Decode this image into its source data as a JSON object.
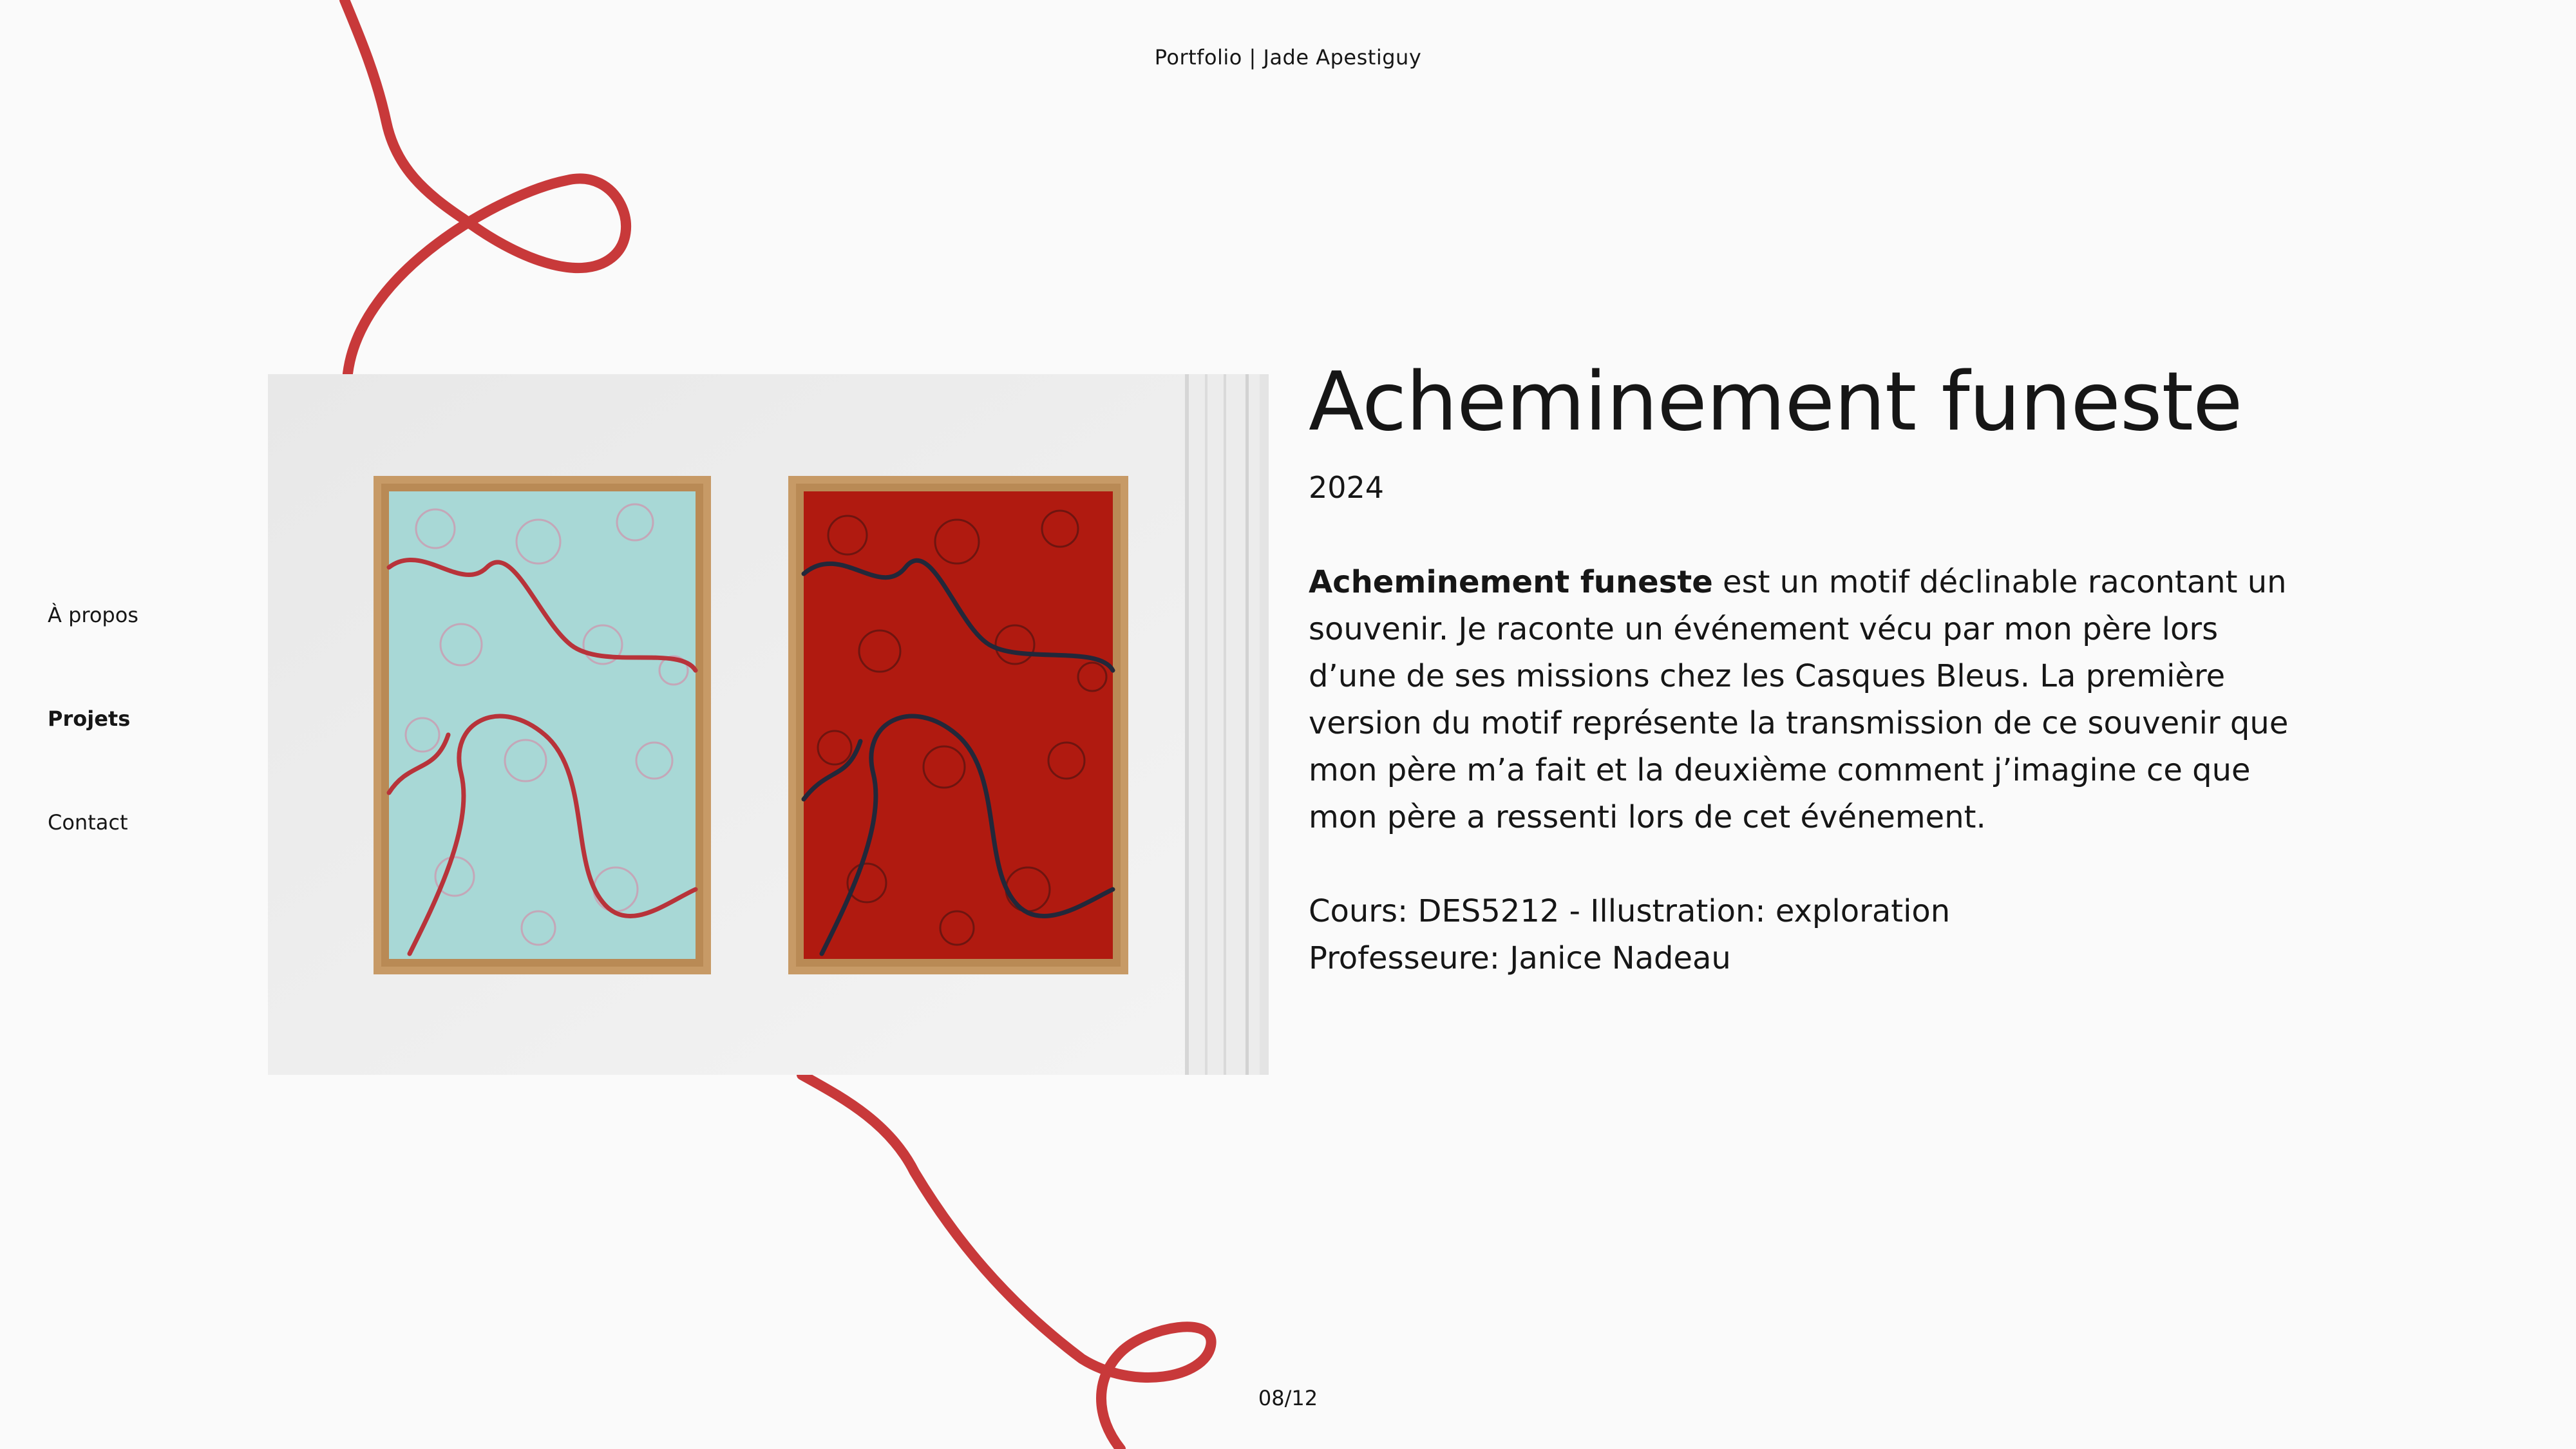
{
  "header": {
    "site_title": "Portfolio | Jade Apestiguy"
  },
  "nav": {
    "items": [
      {
        "label": "À propos",
        "active": false
      },
      {
        "label": "Projets",
        "active": true
      },
      {
        "label": "Contact",
        "active": false
      }
    ]
  },
  "project": {
    "title": "Acheminement funeste",
    "year": "2024",
    "description_strong": "Acheminement funeste",
    "description_rest": " est un motif déclinable racontant un souvenir. Je raconte un événement vécu par mon père lors d’une de ses missions chez les Casques Bleus. La première version du motif représente la transmission de ce souvenir que mon père m’a fait et la deuxième comment j’imagine ce que mon père a ressenti lors de cet événement.",
    "course": "Cours: DES5212 - Illustration: exploration",
    "professor": "Professeure: Janice Nadeau"
  },
  "pagination": {
    "label": "08/12"
  },
  "colors": {
    "accent_red": "#c8393a",
    "background": "#fafafa",
    "text": "#161616",
    "poster_left_bg": "#a8d8d6",
    "poster_right_bg": "#b01a10",
    "frame": "#c79a66"
  }
}
